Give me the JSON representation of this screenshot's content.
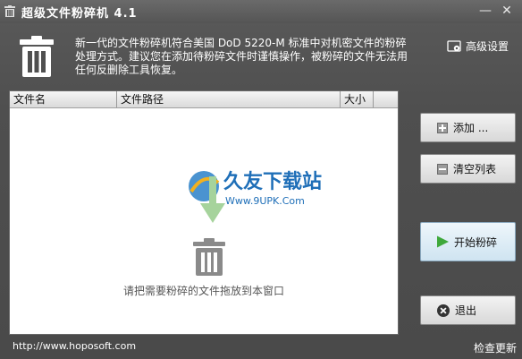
{
  "window": {
    "title": "超级文件粉碎机 4.1",
    "minimize_glyph": "—",
    "close_glyph": "✕"
  },
  "header": {
    "description": "新一代的文件粉碎机符合美国 DoD 5220-M 标准中对机密文件的粉碎处理方式。建议您在添加待粉碎文件时谨慎操作，被粉碎的文件无法用任何反删除工具恢复。",
    "advanced_settings_label": "高级设置",
    "advanced_icon": "gear-icon",
    "trash_icon": "trash-can-icon"
  },
  "table": {
    "columns": [
      "文件名",
      "文件路径",
      "大小"
    ],
    "rows": []
  },
  "drop_area": {
    "hint": "请把需要粉碎的文件拖放到本窗口",
    "arrow_icon": "down-arrow-icon",
    "trash_icon": "trash-can-icon"
  },
  "watermark": {
    "brand": "久友下载站",
    "url": "Www.9UPK.Com"
  },
  "buttons": {
    "add_label": "添加 ...",
    "clear_label": "清空列表",
    "start_label": "开始粉碎",
    "exit_label": "退出"
  },
  "footer": {
    "url": "http://www.hoposoft.com",
    "check_update": "检查更新"
  },
  "colors": {
    "window_bg": "#4a4a4a",
    "start_button_icon": "#3ea83a",
    "drop_arrow": "#a6d39c"
  }
}
